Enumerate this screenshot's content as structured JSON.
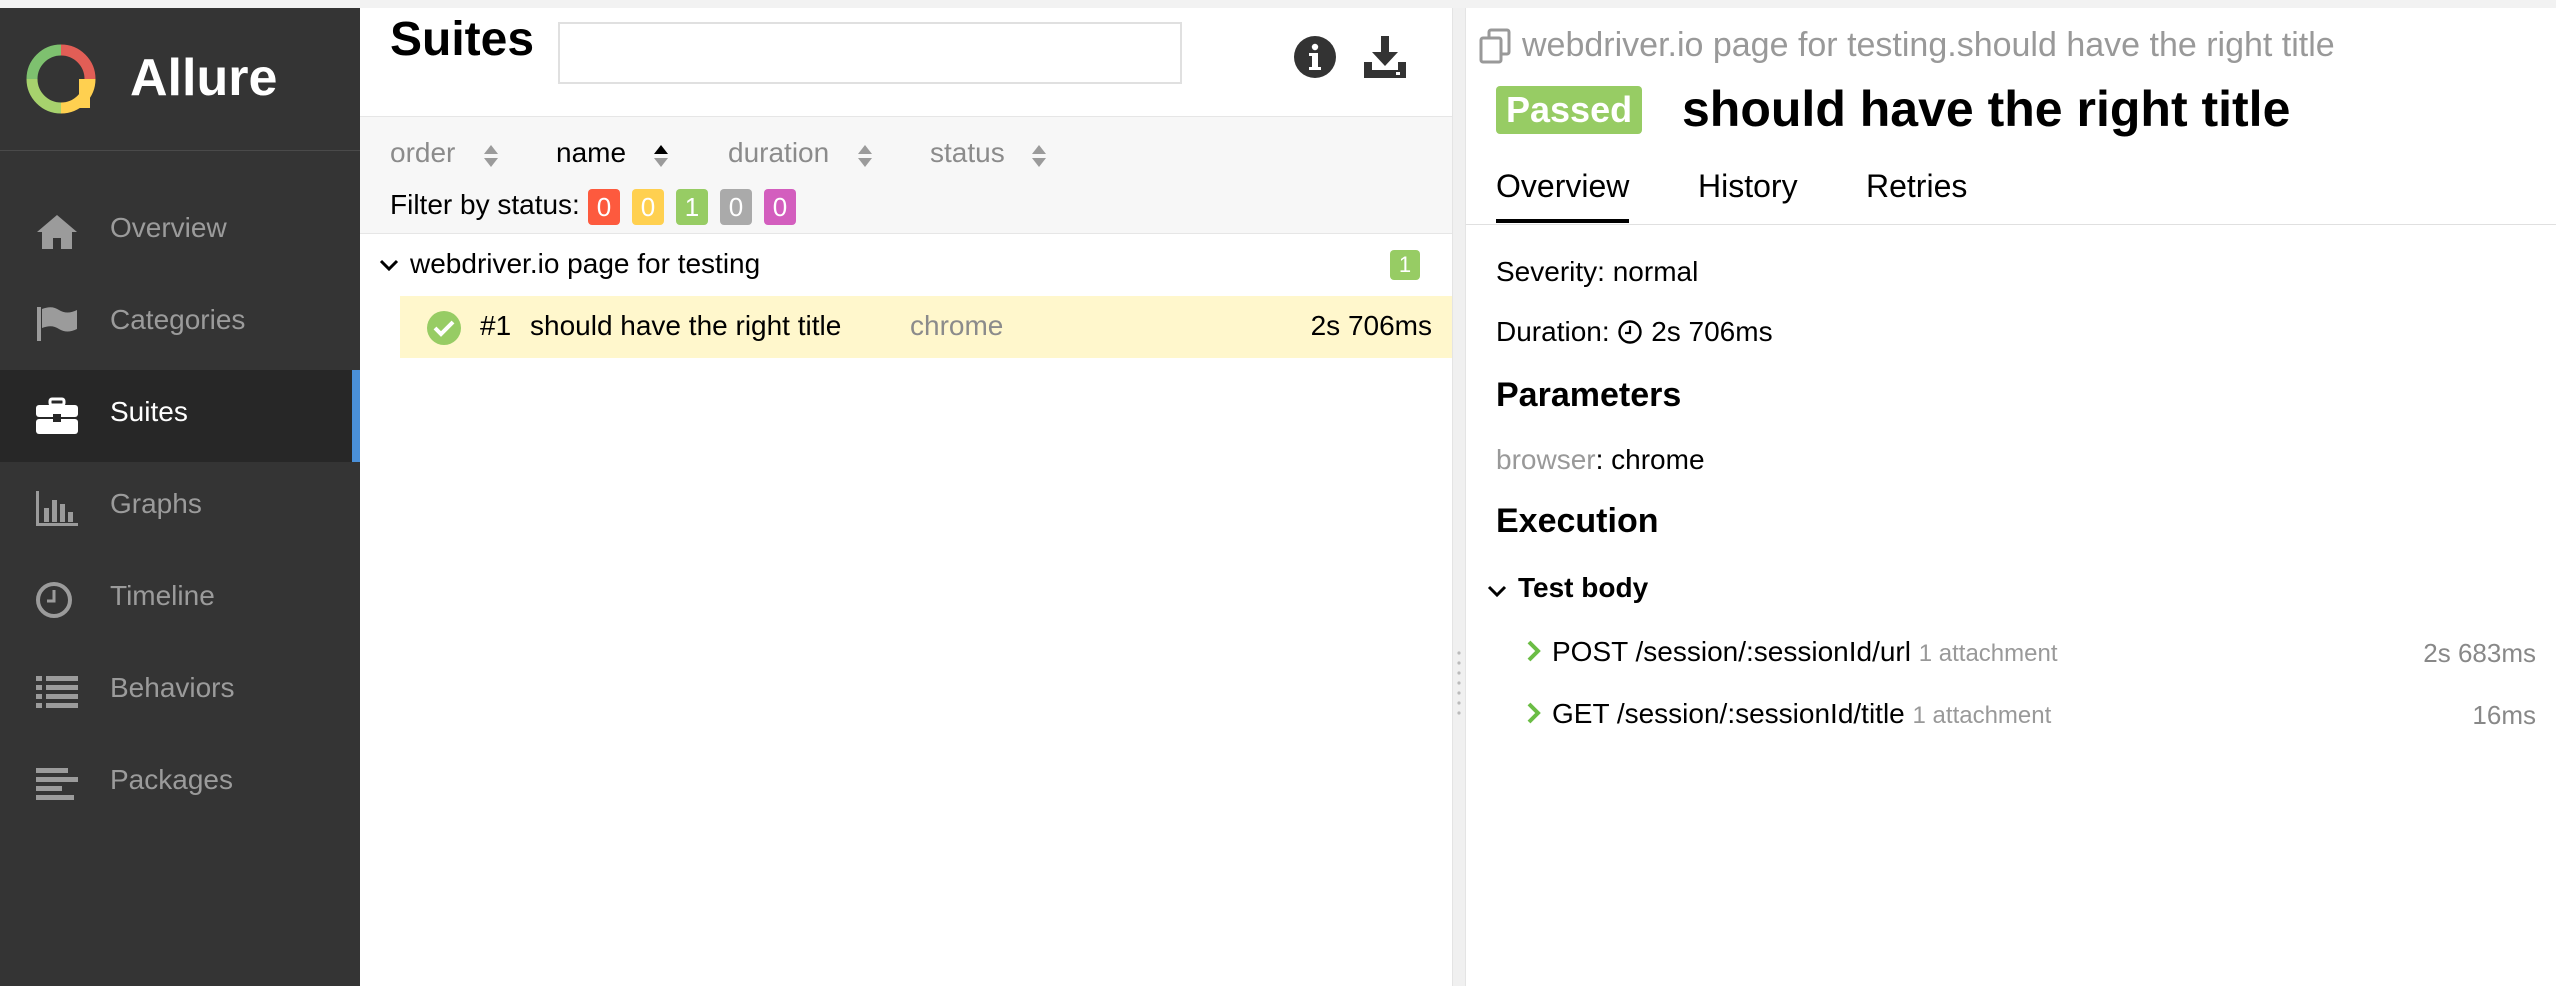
{
  "app": {
    "name": "Allure"
  },
  "sidebar": {
    "items": [
      {
        "label": "Overview",
        "icon": "home-icon",
        "active": false
      },
      {
        "label": "Categories",
        "icon": "flag-icon",
        "active": false
      },
      {
        "label": "Suites",
        "icon": "briefcase-icon",
        "active": true
      },
      {
        "label": "Graphs",
        "icon": "bar-chart-icon",
        "active": false
      },
      {
        "label": "Timeline",
        "icon": "clock-icon",
        "active": false
      },
      {
        "label": "Behaviors",
        "icon": "list-icon",
        "active": false
      },
      {
        "label": "Packages",
        "icon": "align-left-icon",
        "active": false
      }
    ]
  },
  "suites": {
    "title": "Suites",
    "search": {
      "value": "",
      "placeholder": ""
    },
    "sort": [
      "order",
      "name",
      "duration",
      "status"
    ],
    "active_sort": "name",
    "filter_label": "Filter by status:",
    "status_counts": [
      {
        "status": "failed",
        "count": "0",
        "color": "#fd5a3e"
      },
      {
        "status": "broken",
        "count": "0",
        "color": "#ffd050"
      },
      {
        "status": "passed",
        "count": "1",
        "color": "#97cc64"
      },
      {
        "status": "skipped",
        "count": "0",
        "color": "#aaaaaa"
      },
      {
        "status": "unknown",
        "count": "0",
        "color": "#d35ebe"
      }
    ],
    "group": {
      "name": "webdriver.io page for testing",
      "count": "1"
    },
    "tests": [
      {
        "number": "#1",
        "name": "should have the right title",
        "browser": "chrome",
        "duration": "2s 706ms",
        "status": "passed"
      }
    ]
  },
  "detail": {
    "breadcrumb": "webdriver.io page for testing.should have the right title",
    "status_label": "Passed",
    "title": "should have the right title",
    "tabs": [
      "Overview",
      "History",
      "Retries"
    ],
    "severity_label": "Severity:",
    "severity": "normal",
    "duration_label": "Duration:",
    "duration": "2s 706ms",
    "parameters_title": "Parameters",
    "parameter": {
      "key": "browser",
      "value": "chrome"
    },
    "execution_title": "Execution",
    "test_body_label": "Test body",
    "steps": [
      {
        "name": "POST /session/:sessionId/url",
        "attachments": "1 attachment",
        "duration": "2s 683ms"
      },
      {
        "name": "GET /session/:sessionId/title",
        "attachments": "1 attachment",
        "duration": "16ms"
      }
    ]
  },
  "colors": {
    "sidebar_bg": "#343434",
    "accent": "#4a90d9",
    "passed": "#97cc64",
    "row_highlight": "#fff7cc"
  }
}
